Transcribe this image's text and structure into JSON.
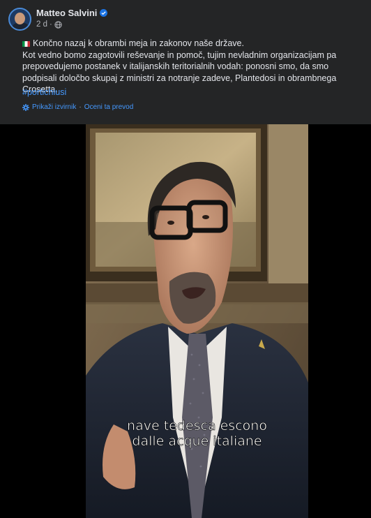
{
  "post": {
    "author": "Matteo Salvini",
    "time": "2 d",
    "line1": "Končno nazaj k obrambi meja in zakonov naše države.",
    "line2": "Kot vedno bomo zagotovili reševanje in pomoč, tujim nevladnim organizacijam pa prepovedujemo postanek v italijanskih teritorialnih vodah: ponosni smo, da smo podpisali določbo skupaj z ministri za notranje zadeve, Plantedosi in obrambnega Crosetta.",
    "hashtag": "#portichiusi",
    "show_original": "Prikaži izvirnik",
    "rate_translation": "Oceni ta prevod"
  },
  "video": {
    "subtitle_line1": "nave tedesca escono",
    "subtitle_line2": "dalle acque italiane"
  },
  "colors": {
    "header_bg": "#242526",
    "text": "#e4e6eb",
    "secondary": "#b0b3b8",
    "link": "#4599ff",
    "verified": "#1b74e4"
  },
  "icons": {
    "verified": "verified-badge-icon",
    "audience": "globe-icon",
    "translate": "gear-icon",
    "flag": "italy-flag-icon"
  }
}
